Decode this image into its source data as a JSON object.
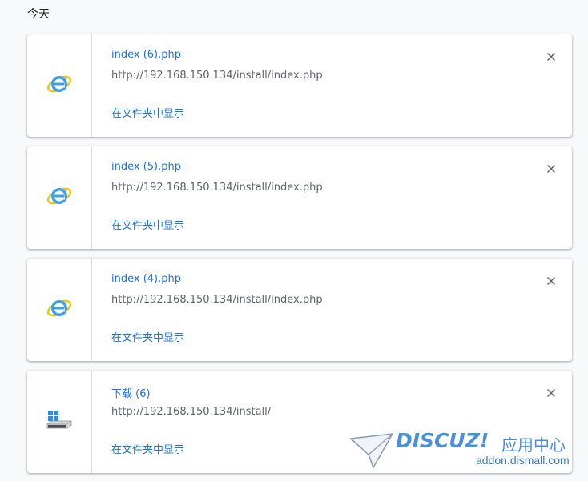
{
  "section": {
    "title": "今天"
  },
  "downloads": [
    {
      "icon": "ie-icon",
      "name": "index (6).php",
      "url": "http://192.168.150.134/install/index.php",
      "show_in_folder": "在文件夹中显示"
    },
    {
      "icon": "ie-icon",
      "name": "index (5).php",
      "url": "http://192.168.150.134/install/index.php",
      "show_in_folder": "在文件夹中显示"
    },
    {
      "icon": "ie-icon",
      "name": "index (4).php",
      "url": "http://192.168.150.134/install/index.php",
      "show_in_folder": "在文件夹中显示"
    },
    {
      "icon": "windows-drive-icon",
      "name": "下载 (6)",
      "url": "http://192.168.150.134/install/",
      "show_in_folder": "在文件夹中显示"
    }
  ],
  "watermark": {
    "brand": "DISCUZ!",
    "subtitle": "应用中心",
    "domain": "addon.dismall.com"
  },
  "colors": {
    "link": "#1a73e8",
    "text_secondary": "#5f6368",
    "background": "#f8f9fa",
    "watermark": "#4a90d9"
  }
}
